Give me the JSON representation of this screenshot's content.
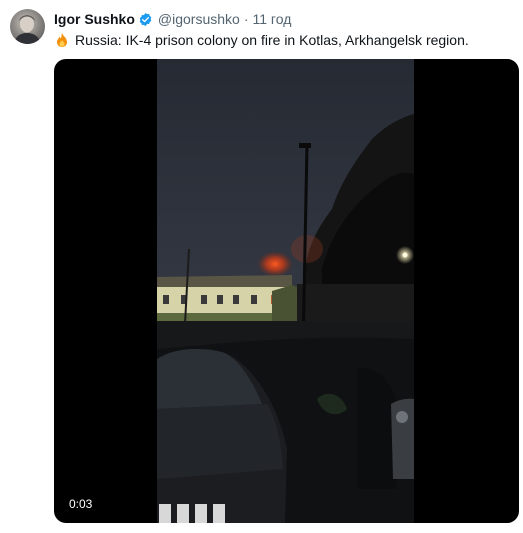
{
  "tweet": {
    "author_name": "Igor Sushko",
    "handle": "@igorsushko",
    "separator": "·",
    "time": "11 год",
    "text": "Russia: IK-4 prison colony on fire in Kotlas, Arkhangelsk region."
  },
  "video": {
    "elapsed": "0:03"
  },
  "icons": {
    "verified": "verified-badge-icon",
    "fire": "fire-emoji-icon"
  },
  "colors": {
    "verified_blue": "#1d9bf0",
    "secondary_text": "#536471"
  }
}
